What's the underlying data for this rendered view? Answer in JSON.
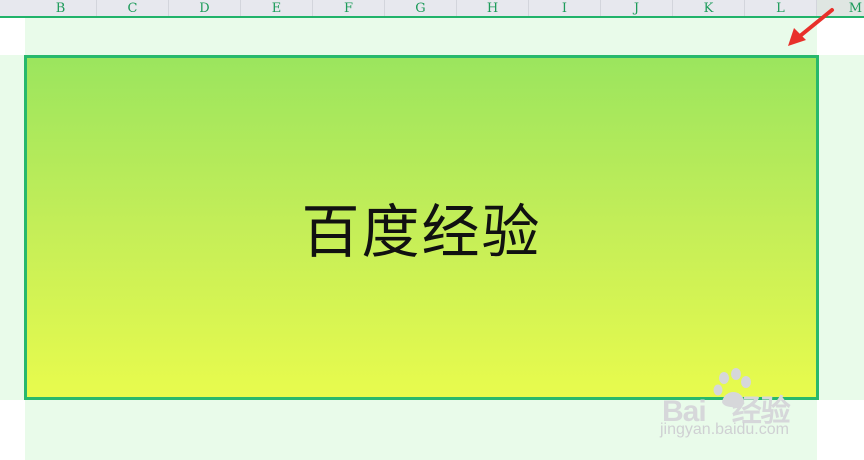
{
  "columns": [
    "B",
    "C",
    "D",
    "E",
    "F",
    "G",
    "H",
    "I",
    "J",
    "K",
    "L",
    "M"
  ],
  "shape": {
    "text": "百度经验"
  },
  "watermark": {
    "brand": "Bai",
    "brand_tail": "经验",
    "url": "jingyan.baidu.com"
  },
  "colors": {
    "accent_green": "#21b36a",
    "gradient_top": "#9be55e",
    "gradient_bottom": "#e8fb4d",
    "sheet_fill": "#e9fbea",
    "arrow_red": "#e8302a"
  },
  "icons": {
    "annotation": "red-arrow-icon",
    "watermark_paw": "baidu-paw-icon"
  }
}
